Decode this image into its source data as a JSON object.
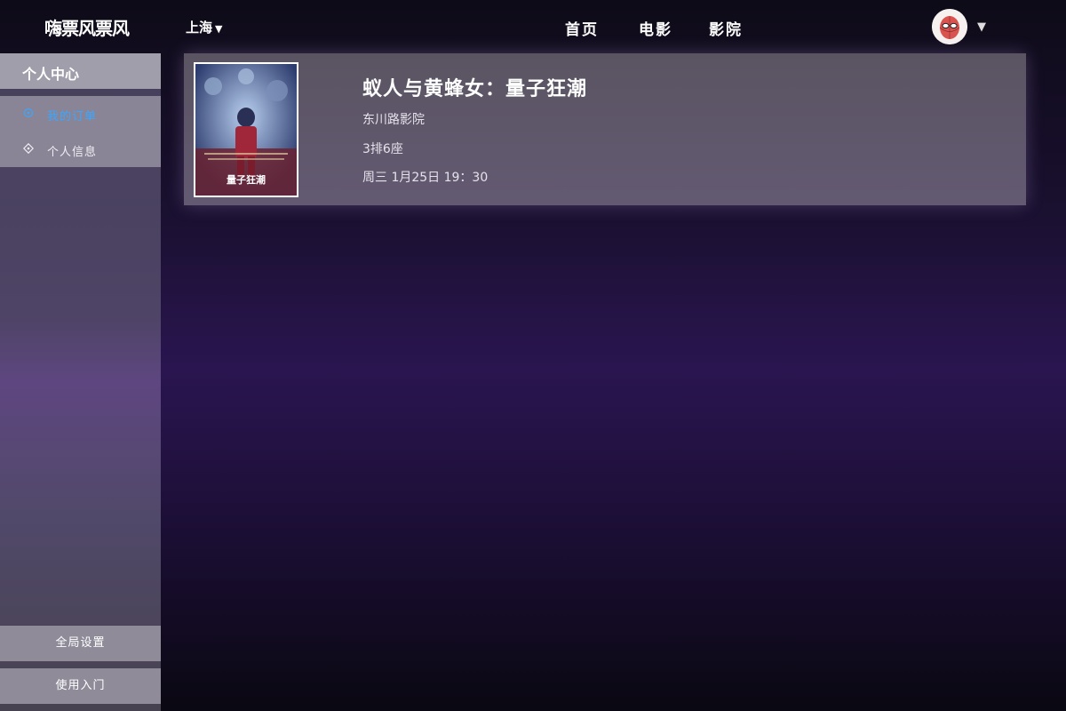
{
  "header": {
    "logo": "嗨票风票风",
    "city": "上海",
    "nav": {
      "home": "首页",
      "movies": "电影",
      "cinemas": "影院"
    }
  },
  "sidebar": {
    "title": "个人中心",
    "items": [
      {
        "label": "我的订单",
        "icon": "ticket-icon",
        "active": true
      },
      {
        "label": "个人信息",
        "icon": "diamond-icon",
        "active": false
      }
    ],
    "bottom": {
      "settings": "全局设置",
      "guide": "使用入门"
    }
  },
  "order": {
    "movie_title": "蚁人与黄蜂女：量子狂潮",
    "cinema": "东川路影院",
    "seat": "3排6座",
    "time": "周三 1月25日 19：30",
    "poster_caption": "量子狂潮"
  },
  "colors": {
    "active_menu": "#3aa6ff",
    "sidebar_title_bg": "#a19eab",
    "card_bg": "#5e5768"
  }
}
